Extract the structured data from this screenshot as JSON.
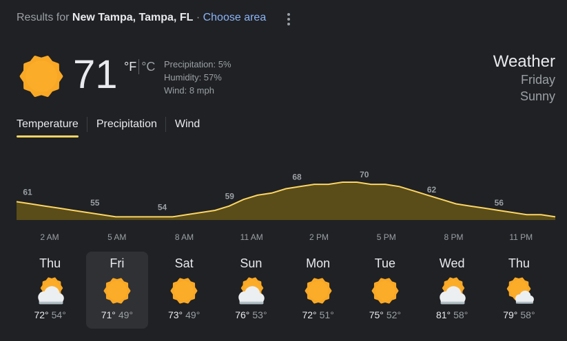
{
  "header": {
    "results_prefix": "Results for",
    "location": "New Tampa, Tampa, FL",
    "separator": "·",
    "choose_area": "Choose area"
  },
  "current": {
    "icon": "sunny-icon",
    "temperature": "71",
    "unit_f": "°F",
    "unit_c": "°C",
    "precipitation": "Precipitation: 5%",
    "humidity": "Humidity: 57%",
    "wind": "Wind: 8 mph"
  },
  "side": {
    "title": "Weather",
    "day": "Friday",
    "condition": "Sunny"
  },
  "tabs": [
    "Temperature",
    "Precipitation",
    "Wind"
  ],
  "active_tab": "Temperature",
  "colors": {
    "accent": "#fdd663",
    "chart_fill": "#5a4d1a",
    "sun": "#f9a825"
  },
  "chart_data": {
    "type": "area",
    "hours": [
      "2 AM",
      "5 AM",
      "8 AM",
      "11 AM",
      "2 PM",
      "5 PM",
      "8 PM",
      "11 PM"
    ],
    "labeled_values": [
      61,
      55,
      54,
      59,
      68,
      70,
      62,
      56
    ],
    "hourly_values": [
      61,
      60,
      59,
      58,
      57,
      56,
      55,
      54,
      54,
      54,
      54,
      54,
      55,
      56,
      57,
      59,
      62,
      64,
      65,
      67,
      68,
      69,
      69,
      70,
      70,
      69,
      69,
      68,
      66,
      64,
      62,
      60,
      59,
      58,
      57,
      56,
      55,
      55,
      54
    ]
  },
  "days": [
    {
      "name": "Thu",
      "icon": "partly-cloudy-icon",
      "hi": "72°",
      "lo": "54°"
    },
    {
      "name": "Fri",
      "icon": "sunny-icon",
      "hi": "71°",
      "lo": "49°",
      "selected": true
    },
    {
      "name": "Sat",
      "icon": "sunny-icon",
      "hi": "73°",
      "lo": "49°"
    },
    {
      "name": "Sun",
      "icon": "partly-cloudy-icon",
      "hi": "76°",
      "lo": "53°"
    },
    {
      "name": "Mon",
      "icon": "sunny-icon",
      "hi": "72°",
      "lo": "51°"
    },
    {
      "name": "Tue",
      "icon": "sunny-icon",
      "hi": "75°",
      "lo": "52°"
    },
    {
      "name": "Wed",
      "icon": "partly-cloudy-icon",
      "hi": "81°",
      "lo": "58°"
    },
    {
      "name": "Thu",
      "icon": "mostly-sunny-icon",
      "hi": "79°",
      "lo": "58°"
    }
  ]
}
